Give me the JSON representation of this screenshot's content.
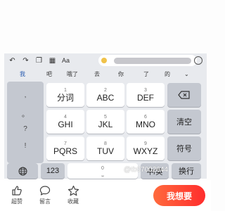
{
  "toolbar": {
    "font_label": "Aa"
  },
  "candidates": [
    "我",
    "吧",
    "哦了",
    "去",
    "你",
    "了",
    "的"
  ],
  "punctuation": [
    ",",
    "。",
    "?",
    "!"
  ],
  "keypad": {
    "rows": [
      [
        {
          "num": "1",
          "label": "分词"
        },
        {
          "num": "2",
          "label": "ABC"
        },
        {
          "num": "3",
          "label": "DEF"
        }
      ],
      [
        {
          "num": "4",
          "label": "GHI"
        },
        {
          "num": "5",
          "label": "JKL"
        },
        {
          "num": "6",
          "label": "MNO"
        }
      ],
      [
        {
          "num": "7",
          "label": "PQRS"
        },
        {
          "num": "8",
          "label": "TUV"
        },
        {
          "num": "9",
          "label": "WXYZ"
        }
      ]
    ],
    "delete_icon": "backspace-icon",
    "clear_label": "清空",
    "symbol_label": "符号",
    "mode_123_label": "123",
    "space_num": "0",
    "lang_label": "中/英",
    "enter_label": "换行"
  },
  "watermark": "@tb07002644",
  "bottom_bar": {
    "like_label": "超赞",
    "comment_label": "留言",
    "fav_label": "收藏",
    "want_label": "我想要",
    "want_color": "#ff3b2f"
  }
}
